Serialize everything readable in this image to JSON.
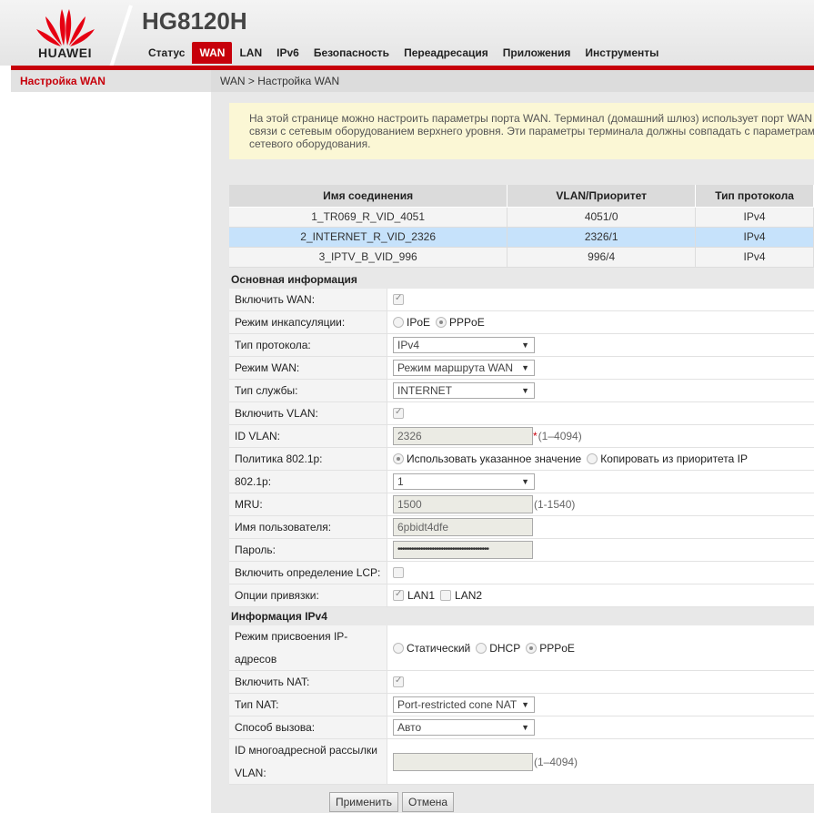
{
  "brand": {
    "logo_text": "HUAWEI",
    "model": "HG8120H",
    "color": "#c7000b"
  },
  "nav": [
    "Статус",
    "WAN",
    "LAN",
    "IPv6",
    "Безопасность",
    "Переадресация",
    "Приложения",
    "Инструменты"
  ],
  "nav_active": "WAN",
  "sidebar": {
    "items": [
      {
        "label": "Настройка WAN"
      }
    ]
  },
  "breadcrumb": "WAN > Настройка WAN",
  "info": [
    "На этой странице можно настроить параметры порта WAN. Терминал (домашний шлюз) использует порт WAN",
    "связи с сетевым оборудованием верхнего уровня. Эти параметры терминала должны совпадать с параметрам",
    "сетевого оборудования."
  ],
  "table": {
    "headers": [
      "Имя соединения",
      "VLAN/Приоритет",
      "Тип протокола"
    ],
    "rows": [
      [
        "1_TR069_R_VID_4051",
        "4051/0",
        "IPv4"
      ],
      [
        "2_INTERNET_R_VID_2326",
        "2326/1",
        "IPv4"
      ],
      [
        "3_IPTV_B_VID_996",
        "996/4",
        "IPv4"
      ]
    ],
    "selected_row": 1
  },
  "basic": {
    "title": "Основная информация",
    "enable_wan": {
      "label": "Включить WAN:",
      "checked": true
    },
    "encap": {
      "label": "Режим инкапсуляции:",
      "options": [
        "IPoE",
        "PPPoE"
      ],
      "selected": "PPPoE"
    },
    "protocol": {
      "label": "Тип протокола:",
      "value": "IPv4"
    },
    "wan_mode": {
      "label": "Режим WAN:",
      "value": "Режим маршрута WAN"
    },
    "service": {
      "label": "Тип службы:",
      "value": "INTERNET"
    },
    "enable_vlan": {
      "label": "Включить VLAN:",
      "checked": true
    },
    "vlan_id": {
      "label": "ID VLAN:",
      "value": "2326",
      "required": "*",
      "hint": "(1–4094)"
    },
    "policy": {
      "label": "Политика 802.1p:",
      "options": [
        "Использовать указанное значение",
        "Копировать из приоритета IP"
      ],
      "selected": "Использовать указанное значение"
    },
    "p8021": {
      "label": "802.1p:",
      "value": "1"
    },
    "mru": {
      "label": "MRU:",
      "value": "1500",
      "hint": "(1-1540)"
    },
    "username": {
      "label": "Имя пользователя:",
      "value": "6pbidt4dfe"
    },
    "password": {
      "label": "Пароль:",
      "value": "••••••••••••••••••••••••••••••••••••••••"
    },
    "lcp": {
      "label": "Включить определение LCP:",
      "checked": false
    },
    "binding": {
      "label": "Опции привязки:",
      "options": [
        "LAN1",
        "LAN2"
      ],
      "checked": [
        true,
        false
      ]
    }
  },
  "ipv4": {
    "title": "Информация IPv4",
    "addr_mode": {
      "label": "Режим присвоения IP-адресов",
      "options": [
        "Статический",
        "DHCP",
        "PPPoE"
      ],
      "selected": "PPPoE"
    },
    "nat": {
      "label": "Включить NAT:",
      "checked": true
    },
    "nat_type": {
      "label": "Тип NAT:",
      "value": "Port-restricted cone NAT"
    },
    "dial": {
      "label": "Способ вызова:",
      "value": "Авто"
    },
    "multicast": {
      "label": "ID многоадресной рассылки VLAN:",
      "value": "",
      "hint": "(1–4094)"
    }
  },
  "buttons": {
    "apply": "Применить",
    "cancel": "Отмена"
  }
}
